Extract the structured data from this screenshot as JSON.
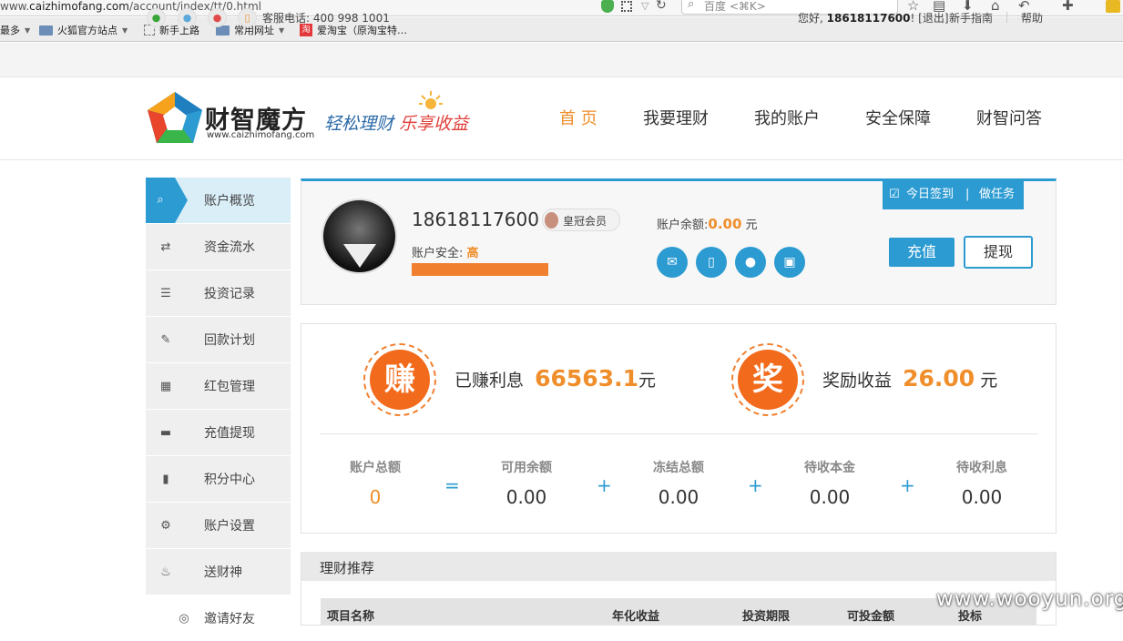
{
  "browser": {
    "url_prefix": "www.",
    "url_host": "caizhimofang.com",
    "url_path": "/account/index/tt/0.html",
    "search_placeholder": "百度 <⌘K>",
    "bookmarks": [
      {
        "label": "最多",
        "icon": "none",
        "caret": true
      },
      {
        "label": "火狐官方站点",
        "icon": "folder-icon",
        "caret": true
      },
      {
        "label": "新手上路",
        "icon": "page-icon",
        "caret": false
      },
      {
        "label": "常用网址",
        "icon": "folder-icon",
        "caret": true
      },
      {
        "label": "爱淘宝（原淘宝特…",
        "icon": "taobao-icon",
        "caret": false
      }
    ]
  },
  "topbar": {
    "hotline": "客服电话: 400 998 1001",
    "greeting_prefix": "您好,",
    "username": "18618117600",
    "greeting_suffix": "! [退出]",
    "newbie": "新手指南",
    "help": "帮助"
  },
  "brand": {
    "name": "财智魔方",
    "url": "www.caizhimofang.com",
    "slogan_a": "轻松理财",
    "slogan_b": "乐享收益"
  },
  "nav": [
    {
      "label": "首 页",
      "active": true
    },
    {
      "label": "我要理财",
      "active": false
    },
    {
      "label": "我的账户",
      "active": false
    },
    {
      "label": "安全保障",
      "active": false
    },
    {
      "label": "财智问答",
      "active": false
    }
  ],
  "sidebar": [
    {
      "label": "账户概览",
      "icon": "search-icon",
      "glyph": "⌕",
      "active": true
    },
    {
      "label": "资金流水",
      "icon": "transfer-icon",
      "glyph": "⇄",
      "active": false
    },
    {
      "label": "投资记录",
      "icon": "list-icon",
      "glyph": "☰",
      "active": false
    },
    {
      "label": "回款计划",
      "icon": "edit-icon",
      "glyph": "✎",
      "active": false
    },
    {
      "label": "红包管理",
      "icon": "gift-icon",
      "glyph": "▦",
      "active": false
    },
    {
      "label": "充值提现",
      "icon": "card-icon",
      "glyph": "▬",
      "active": false
    },
    {
      "label": "积分中心",
      "icon": "bookmark-icon",
      "glyph": "▮",
      "active": false
    },
    {
      "label": "账户设置",
      "icon": "gear-icon",
      "glyph": "⚙",
      "active": false
    },
    {
      "label": "送财神",
      "icon": "fire-icon",
      "glyph": "♨",
      "active": false
    },
    {
      "label": "邀请好友",
      "icon": "target-icon",
      "glyph": "◎",
      "active": false
    }
  ],
  "profile": {
    "phone": "18618117600",
    "member_level": "皇冠会员",
    "security_label": "账户安全:",
    "security_level": "高",
    "security_progress": 1.0,
    "balance_label": "账户余额:",
    "balance_value": "0.00",
    "balance_unit": "元",
    "verify_icons": [
      "mail-icon",
      "mobile-icon",
      "user-icon",
      "lock-icon"
    ],
    "signin_label": "今日签到",
    "task_label": "做任务",
    "recharge_label": "充值",
    "withdraw_label": "提现"
  },
  "earnings": {
    "interest_badge": "赚",
    "interest_label": "已赚利息",
    "interest_value": "66563.1",
    "interest_unit": "元",
    "reward_badge": "奖",
    "reward_label": "奖励收益",
    "reward_value": "26.00",
    "reward_unit": "元"
  },
  "summary": {
    "items": [
      {
        "label": "账户总额",
        "value": "0"
      },
      {
        "label": "可用余额",
        "value": "0.00"
      },
      {
        "label": "冻结总额",
        "value": "0.00"
      },
      {
        "label": "待收本金",
        "value": "0.00"
      },
      {
        "label": "待收利息",
        "value": "0.00"
      }
    ],
    "operators": [
      "=",
      "+",
      "+",
      "+"
    ]
  },
  "recommend": {
    "title": "理财推荐",
    "columns": [
      "项目名称",
      "年化收益",
      "投资期限",
      "可投金额",
      "投标"
    ]
  },
  "watermark": "www.wooyun.org",
  "colors": {
    "accent": "#2c9bd2",
    "orange": "#f08e2b",
    "badge": "#f26a1b"
  }
}
